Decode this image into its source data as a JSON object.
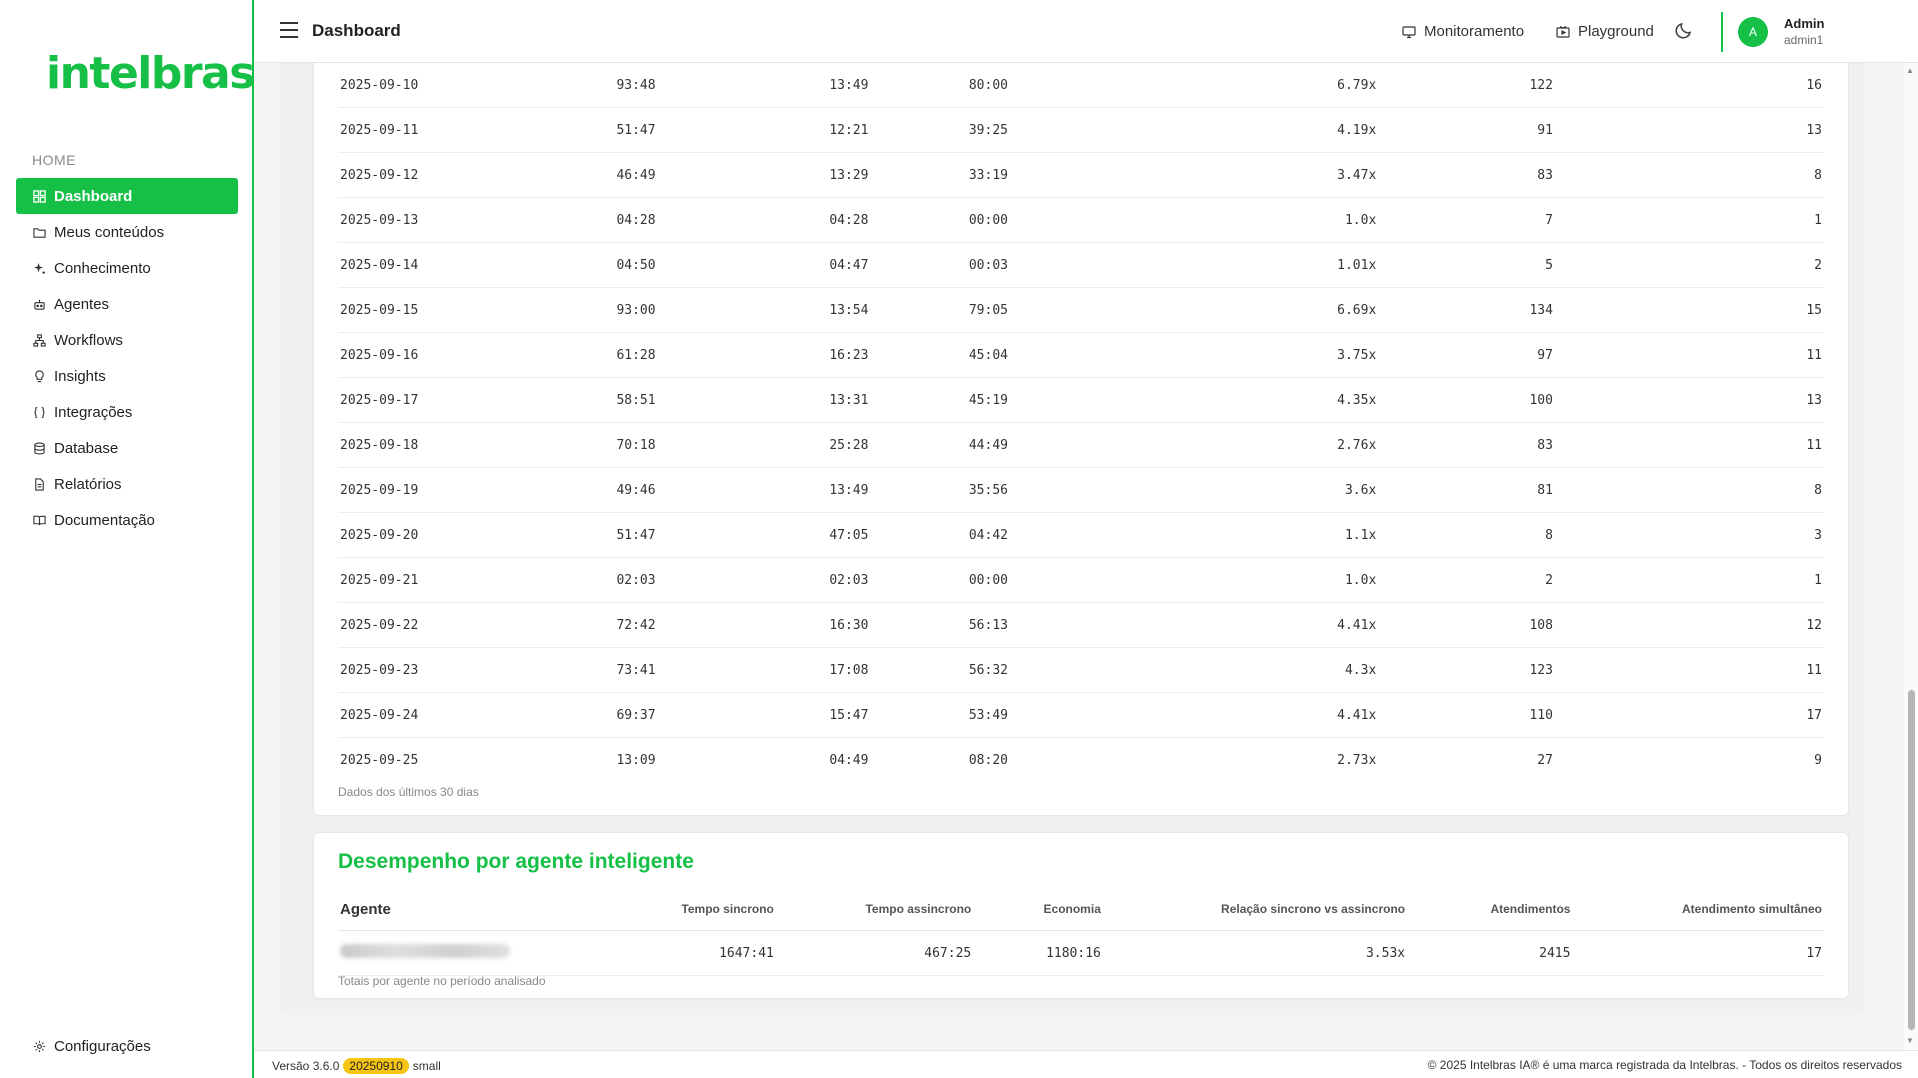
{
  "brand": {
    "logo_text": "intelbras",
    "accent": "#16c047",
    "badge_color": "#f6c514"
  },
  "header": {
    "title": "Dashboard",
    "links": {
      "monitoring": "Monitoramento",
      "playground": "Playground"
    },
    "user": {
      "avatar": "A",
      "name": "Admin",
      "username": "admin1"
    }
  },
  "sidebar": {
    "section": "HOME",
    "items": [
      {
        "label": "Dashboard",
        "icon": "grid-icon",
        "active": true
      },
      {
        "label": "Meus conteúdos",
        "icon": "folder-icon"
      },
      {
        "label": "Conhecimento",
        "icon": "sparkle-icon"
      },
      {
        "label": "Agentes",
        "icon": "robot-icon"
      },
      {
        "label": "Workflows",
        "icon": "workflow-icon"
      },
      {
        "label": "Insights",
        "icon": "lightbulb-icon"
      },
      {
        "label": "Integrações",
        "icon": "braces-icon"
      },
      {
        "label": "Database",
        "icon": "database-icon"
      },
      {
        "label": "Relatórios",
        "icon": "file-icon"
      },
      {
        "label": "Documentação",
        "icon": "book-icon"
      }
    ],
    "settings": {
      "label": "Configurações",
      "icon": "gear-icon"
    }
  },
  "daily": {
    "rows": [
      [
        "2025-09-10",
        "93:48",
        "13:49",
        "80:00",
        "6.79x",
        "122",
        "16"
      ],
      [
        "2025-09-11",
        "51:47",
        "12:21",
        "39:25",
        "4.19x",
        "91",
        "13"
      ],
      [
        "2025-09-12",
        "46:49",
        "13:29",
        "33:19",
        "3.47x",
        "83",
        "8"
      ],
      [
        "2025-09-13",
        "04:28",
        "04:28",
        "00:00",
        "1.0x",
        "7",
        "1"
      ],
      [
        "2025-09-14",
        "04:50",
        "04:47",
        "00:03",
        "1.01x",
        "5",
        "2"
      ],
      [
        "2025-09-15",
        "93:00",
        "13:54",
        "79:05",
        "6.69x",
        "134",
        "15"
      ],
      [
        "2025-09-16",
        "61:28",
        "16:23",
        "45:04",
        "3.75x",
        "97",
        "11"
      ],
      [
        "2025-09-17",
        "58:51",
        "13:31",
        "45:19",
        "4.35x",
        "100",
        "13"
      ],
      [
        "2025-09-18",
        "70:18",
        "25:28",
        "44:49",
        "2.76x",
        "83",
        "11"
      ],
      [
        "2025-09-19",
        "49:46",
        "13:49",
        "35:56",
        "3.6x",
        "81",
        "8"
      ],
      [
        "2025-09-20",
        "51:47",
        "47:05",
        "04:42",
        "1.1x",
        "8",
        "3"
      ],
      [
        "2025-09-21",
        "02:03",
        "02:03",
        "00:00",
        "1.0x",
        "2",
        "1"
      ],
      [
        "2025-09-22",
        "72:42",
        "16:30",
        "56:13",
        "4.41x",
        "108",
        "12"
      ],
      [
        "2025-09-23",
        "73:41",
        "17:08",
        "56:32",
        "4.3x",
        "123",
        "11"
      ],
      [
        "2025-09-24",
        "69:37",
        "15:47",
        "53:49",
        "4.41x",
        "110",
        "17"
      ],
      [
        "2025-09-25",
        "13:09",
        "04:49",
        "08:20",
        "2.73x",
        "27",
        "9"
      ]
    ],
    "note": "Dados dos últimos 30 dias"
  },
  "agents": {
    "title": "Desempenho por agente inteligente",
    "headers": [
      "Agente",
      "Tempo sincrono",
      "Tempo assincrono",
      "Economia",
      "Relação sincrono vs assincrono",
      "Atendimentos",
      "Atendimento simultâneo"
    ],
    "rows": [
      [
        "",
        "1647:41",
        "467:25",
        "1180:16",
        "3.53x",
        "2415",
        "17"
      ]
    ],
    "note": "Totais por agente no período analisado"
  },
  "footer": {
    "version_prefix": "Versão 3.6.0",
    "build": "20250910",
    "size": "small",
    "copyright": "© 2025 Intelbras IA® é uma marca registrada da Intelbras. - Todos os direitos reservados"
  }
}
